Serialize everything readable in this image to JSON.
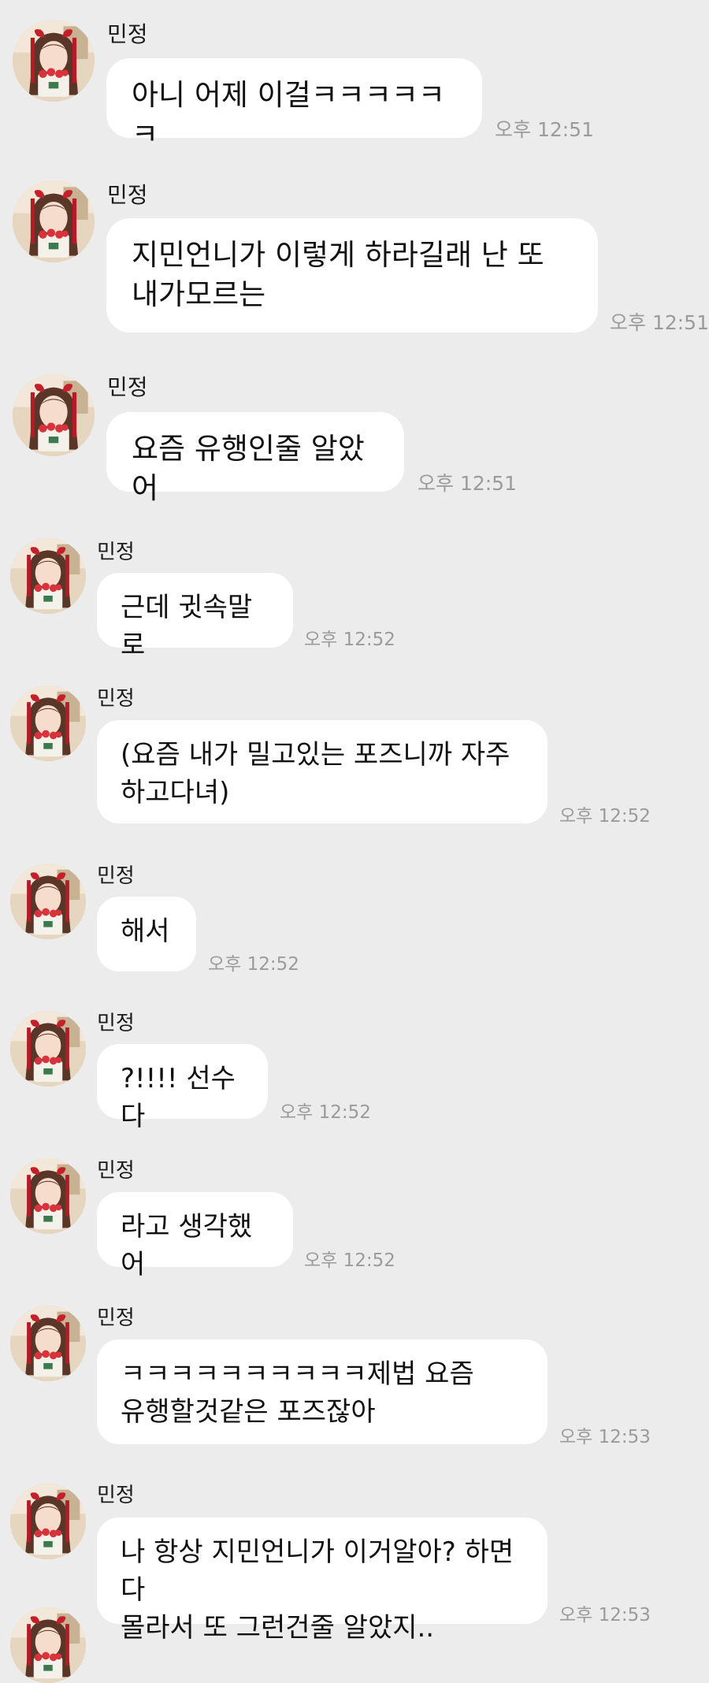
{
  "chat": {
    "messages": [
      {
        "sender": "민정",
        "text": "아니 어제 이걸ㅋㅋㅋㅋㅋㅋ",
        "time": "오후 12:51"
      },
      {
        "sender": "민정",
        "text": "지민언니가 이렇게 하라길래 난 또\n내가모르는",
        "time": "오후 12:51"
      },
      {
        "sender": "민정",
        "text": "요즘 유행인줄 알았어",
        "time": "오후 12:51"
      },
      {
        "sender": "민정",
        "text": "근데 귓속말로",
        "time": "오후 12:52"
      },
      {
        "sender": "민정",
        "text": "(요즘 내가 밀고있는 포즈니까 자주\n하고다녀)",
        "time": "오후 12:52"
      },
      {
        "sender": "민정",
        "text": "해서",
        "time": "오후 12:52"
      },
      {
        "sender": "민정",
        "text": "?!!!! 선수다",
        "time": "오후 12:52"
      },
      {
        "sender": "민정",
        "text": "라고 생각했어",
        "time": "오후 12:52"
      },
      {
        "sender": "민정",
        "text": "ㅋㅋㅋㅋㅋㅋㅋㅋㅋㅋ제법 요즘\n유행할것같은 포즈잖아",
        "time": "오후 12:53"
      },
      {
        "sender": "민정",
        "text": "나 항상 지민언니가 이거알아? 하면 다\n몰라서 또 그런건줄 알았지..",
        "time": "오후 12:53"
      }
    ]
  },
  "colors": {
    "background": "#ececec",
    "bubble": "#ffffff",
    "timestamp": "#9b9b9b"
  },
  "icons": {
    "avatar": "profile-photo-avatar"
  }
}
